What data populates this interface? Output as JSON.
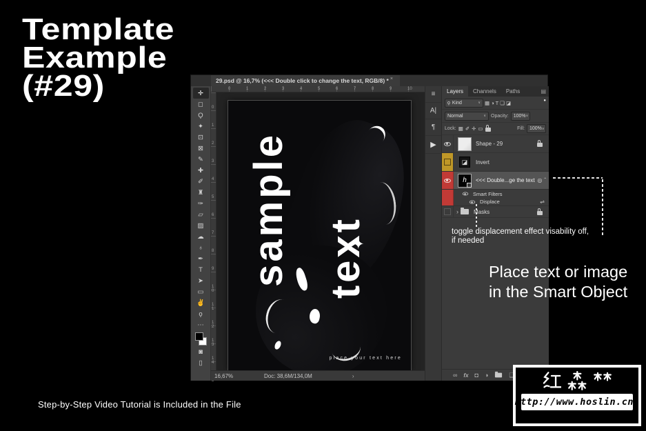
{
  "page": {
    "background": "#000000"
  },
  "hero": {
    "line1": "Template",
    "line2": "Example",
    "line3": "(#29)"
  },
  "footer_note": "Step-by-Step Video Tutorial is Included in the File",
  "watermark": {
    "brand": "红森林",
    "url": "http://www.hoslin.cn/"
  },
  "callouts": {
    "displacement_line1": "toggle displacement effect visability off,",
    "displacement_line2": "if needed",
    "smart_object_line1": "Place text or image",
    "smart_object_line2": "in the Smart Object"
  },
  "photoshop": {
    "title_bar": {
      "text": "29.psd @ 16,7% (<<<  Double click to change the text, RGB/8) *",
      "close_mark": "×"
    },
    "toolbar": {
      "tools": [
        {
          "name": "move-tool",
          "glyph": "✛"
        },
        {
          "name": "rectangular-marquee-tool",
          "glyph": "◻"
        },
        {
          "name": "lasso-tool",
          "glyph": "Ϙ"
        },
        {
          "name": "quick-selection-tool",
          "glyph": "✦"
        },
        {
          "name": "crop-tool",
          "glyph": "⊡"
        },
        {
          "name": "frame-tool",
          "glyph": "⊠"
        },
        {
          "name": "eyedropper-tool",
          "glyph": "✎"
        },
        {
          "name": "healing-brush-tool",
          "glyph": "✚"
        },
        {
          "name": "brush-tool",
          "glyph": "✐"
        },
        {
          "name": "clone-stamp-tool",
          "glyph": "♜"
        },
        {
          "name": "history-brush-tool",
          "glyph": "✑"
        },
        {
          "name": "eraser-tool",
          "glyph": "▱"
        },
        {
          "name": "gradient-tool",
          "glyph": "▨"
        },
        {
          "name": "smudge-tool",
          "glyph": "☁"
        },
        {
          "name": "dodge-tool",
          "glyph": "♁"
        },
        {
          "name": "pen-tool",
          "glyph": "✒"
        },
        {
          "name": "type-tool",
          "glyph": "T"
        },
        {
          "name": "path-selection-tool",
          "glyph": "➤"
        },
        {
          "name": "rectangle-tool",
          "glyph": "▭"
        },
        {
          "name": "hand-tool",
          "glyph": "✌"
        },
        {
          "name": "zoom-tool",
          "glyph": "ϙ"
        },
        {
          "name": "more-tools",
          "glyph": "⋯"
        }
      ],
      "quick_mask_glyph": "◙",
      "screen_mode_glyph": "▯",
      "foreground_color": "#000000",
      "background_color": "#ffffff"
    },
    "rulers": {
      "h": [
        "0",
        "1",
        "2",
        "3",
        "4",
        "5",
        "6",
        "7",
        "8",
        "9",
        "10"
      ],
      "v": [
        "0",
        "1",
        "2",
        "3",
        "4",
        "5",
        "6",
        "7",
        "8",
        "9",
        "1\n0",
        "1\n1",
        "1\n2",
        "1\n3",
        "1\n4",
        "1\n5"
      ]
    },
    "canvas": {
      "word_vertical_1": "sample",
      "word_vertical_2": "text",
      "placeholder": "place your text here",
      "sparkle_glyph": "✦"
    },
    "status_bar": {
      "zoom_level": "16,67%",
      "doc_size": "Doc: 38,6M/134,0M",
      "expand_arrow": "›"
    },
    "panel_strip": {
      "properties_glyph": "≡",
      "character_glyph": "A|",
      "paragraph_glyph": "¶",
      "expand_glyph": "▶"
    },
    "layers_panel": {
      "tabs": [
        {
          "label": "Layers"
        },
        {
          "label": "Channels"
        },
        {
          "label": "Paths"
        }
      ],
      "panel_menu_glyph": "▤",
      "filter_row": {
        "search_glyph": "ϙ",
        "kind": "Kind",
        "chevron": "∨",
        "type_icons": [
          "▦",
          "◑",
          "T",
          "❏",
          "◪"
        ],
        "pin_glyph": "●"
      },
      "blend_row": {
        "mode": "Normal",
        "chevron": "∨",
        "opacity_label": "Opacity:",
        "opacity_value": "100%"
      },
      "lock_row": {
        "label": "Lock:",
        "icons": [
          "▦",
          "✐",
          "✛",
          "▭"
        ],
        "fill_label": "Fill:",
        "fill_value": "100%"
      },
      "label_colors": {
        "yellow": "#bf9727",
        "red": "#c13a36"
      },
      "layers": {
        "shape": {
          "name": "Shape - 29"
        },
        "invert": {
          "name": "Invert"
        },
        "smart_object": {
          "name": "<<<  Double...ge the text",
          "thumb_letter": "h",
          "fx_glyph": "◎",
          "collapse_glyph": "ˆ"
        },
        "smart_filters": {
          "name": "Smart Filters"
        },
        "displace": {
          "name": "Displace",
          "options_glyph": "⇌"
        },
        "masks": {
          "name": "Masks",
          "collapse_glyph": "›"
        }
      },
      "bottom_bar": {
        "link_glyph": "∞",
        "fx_label": "fx",
        "mask_glyph": "◘",
        "adjust_glyph": "◑",
        "new_layer_glyph": "❏"
      }
    }
  }
}
